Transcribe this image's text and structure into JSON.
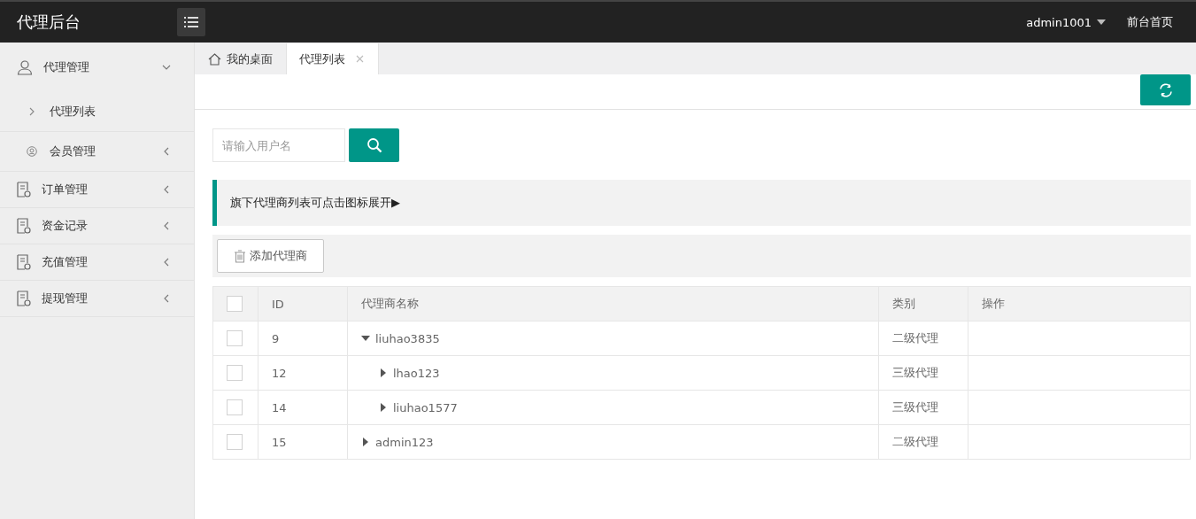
{
  "header": {
    "logo": "代理后台",
    "user": "admin1001",
    "home_link": "前台首页"
  },
  "sidebar": {
    "items": [
      {
        "label": "代理管理",
        "expanded": true,
        "children": [
          {
            "label": "代理列表",
            "kind": "link"
          },
          {
            "label": "会员管理",
            "kind": "group",
            "expanded": false
          }
        ]
      },
      {
        "label": "订单管理",
        "expanded": false
      },
      {
        "label": "资金记录",
        "expanded": false
      },
      {
        "label": "充值管理",
        "expanded": false
      },
      {
        "label": "提现管理",
        "expanded": false
      }
    ]
  },
  "tabs": [
    {
      "label": "我的桌面",
      "kind": "home",
      "selected": false,
      "closable": false
    },
    {
      "label": "代理列表",
      "kind": "page",
      "selected": true,
      "closable": true
    }
  ],
  "search": {
    "placeholder": "请输入用户名"
  },
  "notice": "旗下代理商列表可点击图标展开▶",
  "add_button": "添加代理商",
  "table": {
    "select_all_checked": false,
    "columns": [
      "ID",
      "代理商名称",
      "类别",
      "操作"
    ],
    "rows": [
      {
        "id": "9",
        "name": "liuhao3835",
        "type": "二级代理",
        "checked": false,
        "expanded": true,
        "children": [
          {
            "id": "12",
            "name": "lhao123",
            "type": "三级代理",
            "checked": false,
            "expanded": false
          },
          {
            "id": "14",
            "name": "liuhao1577",
            "type": "三级代理",
            "checked": false,
            "expanded": false
          }
        ]
      },
      {
        "id": "15",
        "name": "admin123",
        "type": "二级代理",
        "checked": false,
        "expanded": false
      }
    ]
  }
}
